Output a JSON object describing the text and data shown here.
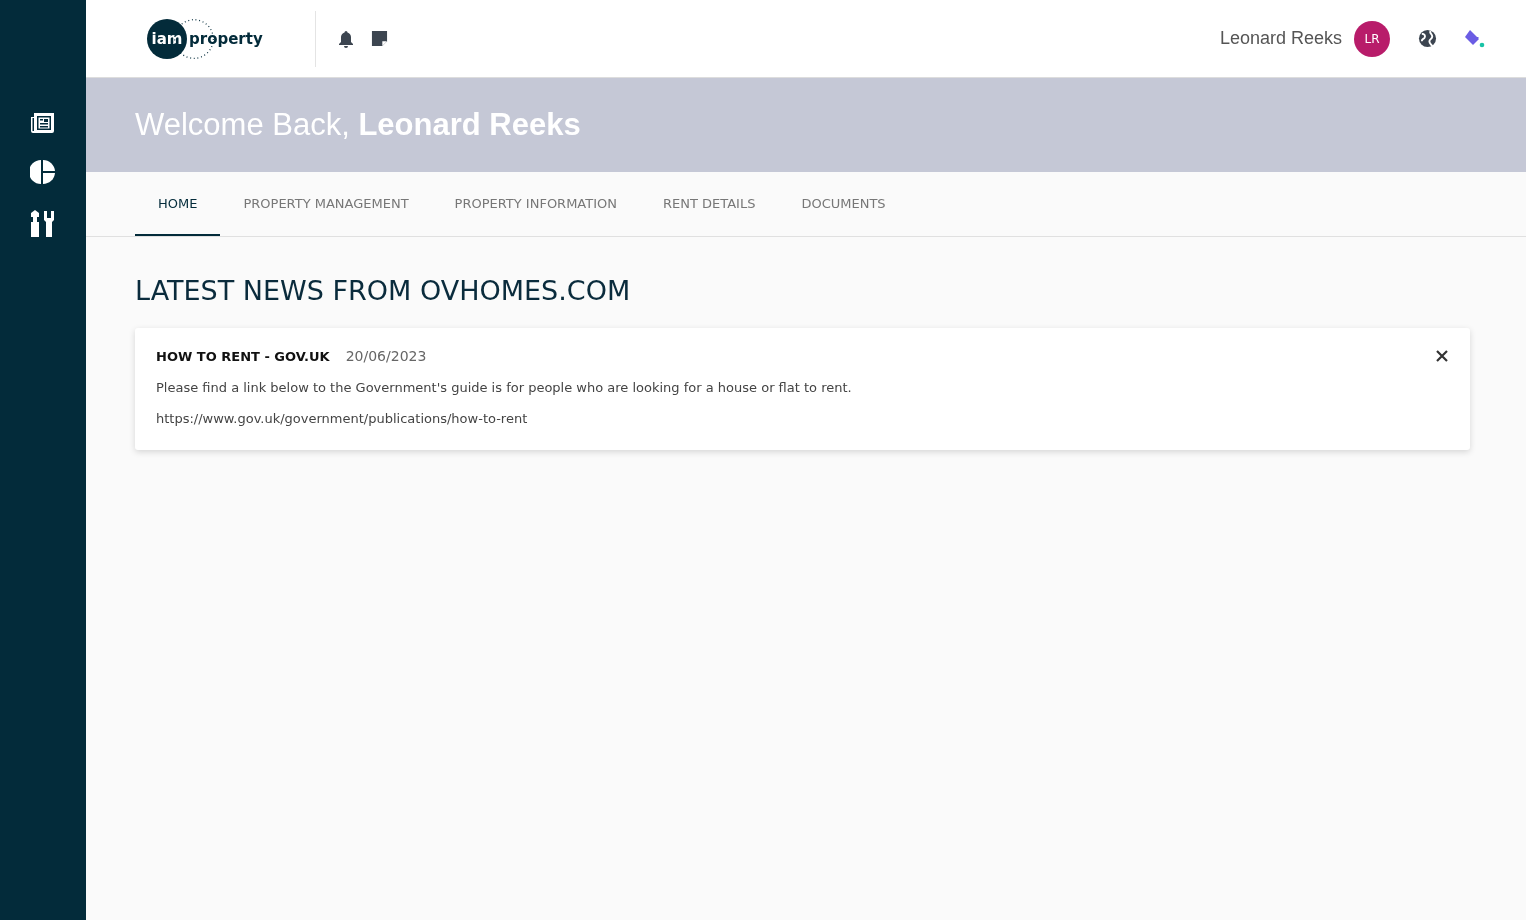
{
  "logo": {
    "circle_text": "iam",
    "text": "property"
  },
  "user": {
    "name": "Leonard Reeks",
    "initials": "LR"
  },
  "welcome": {
    "greeting": "Welcome Back,",
    "name": "Leonard Reeks"
  },
  "tabs": [
    {
      "label": "HOME",
      "selected": true
    },
    {
      "label": "PROPERTY MANAGEMENT",
      "selected": false
    },
    {
      "label": "PROPERTY INFORMATION",
      "selected": false
    },
    {
      "label": "RENT DETAILS",
      "selected": false
    },
    {
      "label": "DOCUMENTS",
      "selected": false
    }
  ],
  "news": {
    "heading": "LATEST NEWS FROM OVHOMES.COM",
    "items": [
      {
        "title": "HOW TO RENT - GOV.UK",
        "date": "20/06/2023",
        "body": "Please find a link below to the Government's guide is for people who are looking for a house or flat to rent.",
        "link": "https://www.gov.uk/government/publications/how-to-rent"
      }
    ]
  }
}
